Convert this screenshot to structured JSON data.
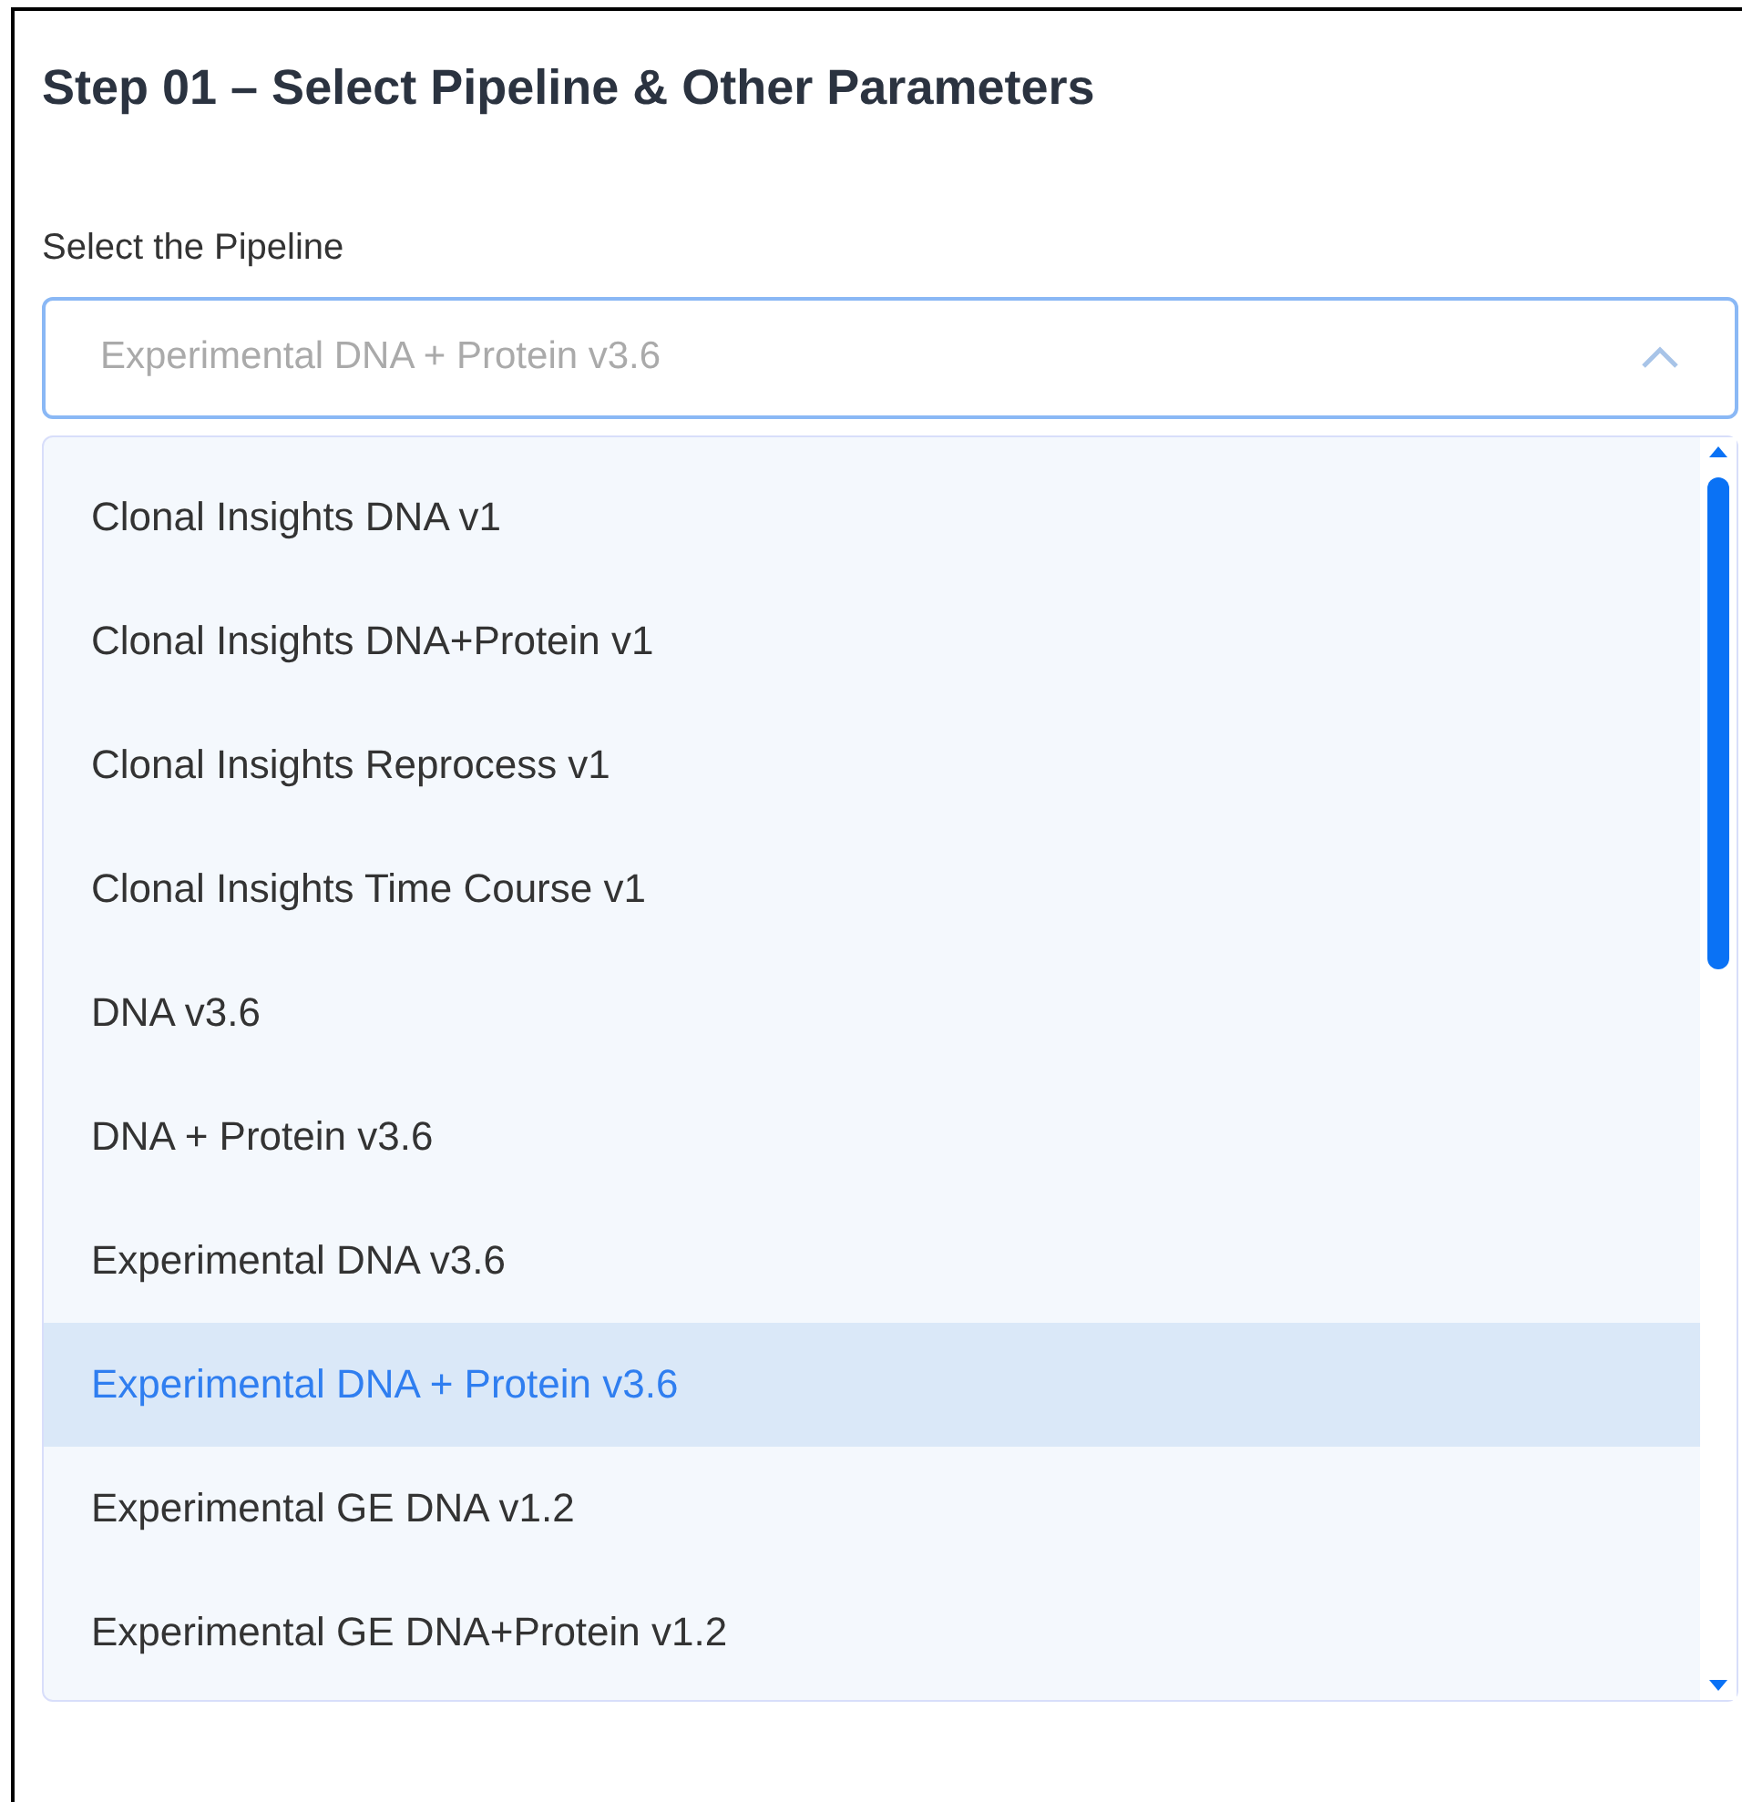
{
  "title": "Step 01 – Select Pipeline & Other Parameters",
  "pipeline_field": {
    "label": "Select the Pipeline",
    "placeholder": "Experimental DNA + Protein v3.6",
    "expanded": true
  },
  "options": [
    {
      "label": "Clonal Insights DNA v1",
      "selected": false
    },
    {
      "label": "Clonal Insights DNA+Protein v1",
      "selected": false
    },
    {
      "label": "Clonal Insights Reprocess v1",
      "selected": false
    },
    {
      "label": "Clonal Insights Time Course v1",
      "selected": false
    },
    {
      "label": "DNA v3.6",
      "selected": false
    },
    {
      "label": "DNA + Protein v3.6",
      "selected": false
    },
    {
      "label": "Experimental DNA v3.6",
      "selected": false
    },
    {
      "label": "Experimental DNA + Protein v3.6",
      "selected": true
    },
    {
      "label": "Experimental GE DNA v1.2",
      "selected": false
    },
    {
      "label": "Experimental GE DNA+Protein v1.2",
      "selected": false
    }
  ]
}
